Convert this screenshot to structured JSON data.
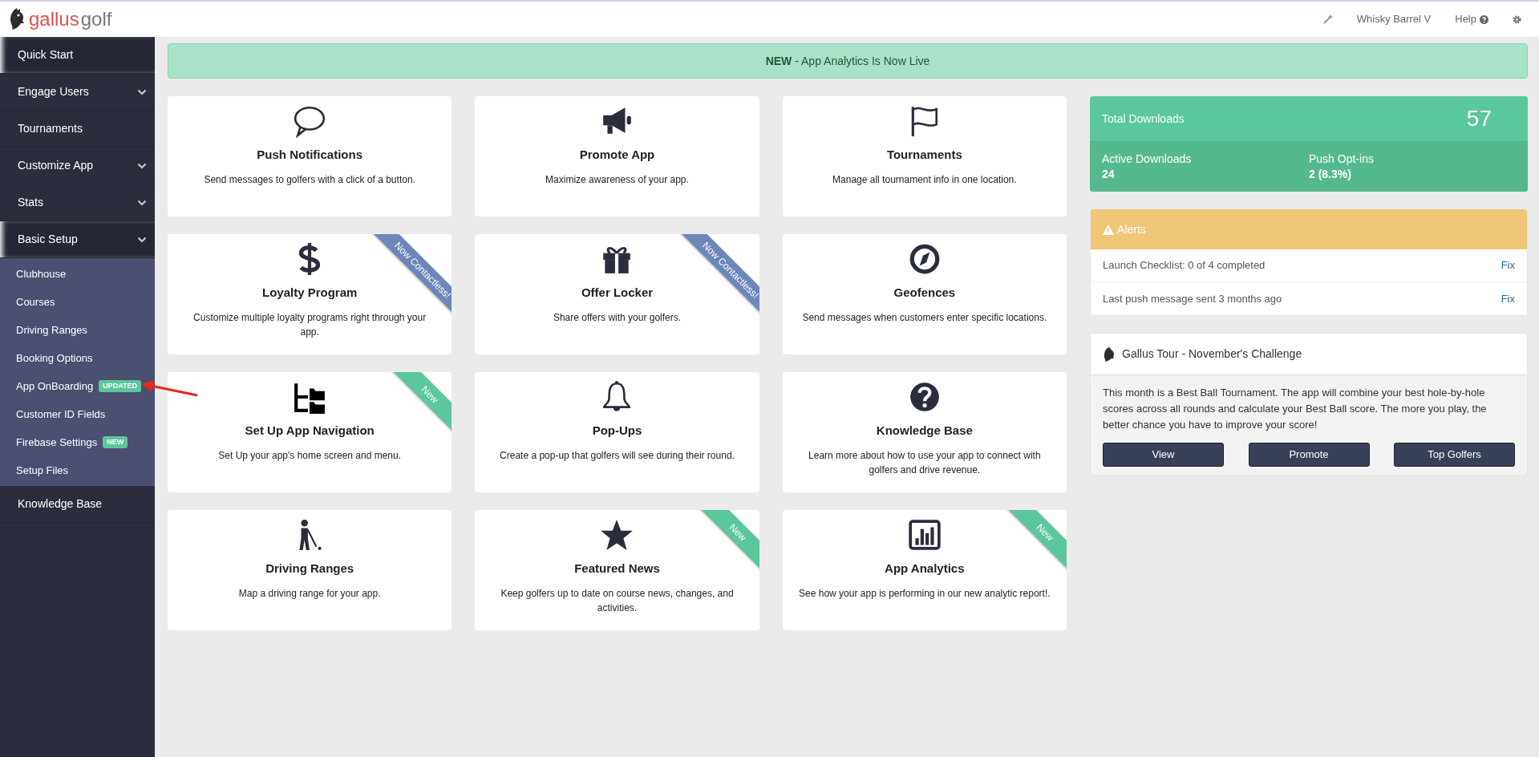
{
  "header": {
    "logo": {
      "word_1": "gallus",
      "word_2": "golf"
    },
    "links": [
      {
        "kind": "wand"
      },
      {
        "kind": "text",
        "label": "Whisky Barrel V"
      },
      {
        "kind": "help",
        "label": "Help"
      },
      {
        "kind": "gear"
      }
    ]
  },
  "sidebar": {
    "items": [
      {
        "label": "Quick Start",
        "kind": "link",
        "selected": true
      },
      {
        "label": "Engage Users",
        "kind": "group",
        "selected": false
      },
      {
        "label": "Tournaments",
        "kind": "link",
        "selected": false
      },
      {
        "label": "Customize App",
        "kind": "group",
        "selected": false
      },
      {
        "label": "Stats",
        "kind": "group",
        "selected": false
      },
      {
        "label": "Basic Setup",
        "kind": "group",
        "selected": true,
        "children": [
          {
            "label": "Clubhouse"
          },
          {
            "label": "Courses"
          },
          {
            "label": "Driving Ranges"
          },
          {
            "label": "Booking Options"
          },
          {
            "label": "App OnBoarding",
            "badge": {
              "text": "UPDATED",
              "color": "#5bc79c"
            },
            "pointer": true
          },
          {
            "label": "Customer ID Fields"
          },
          {
            "label": "Firebase Settings",
            "badge": {
              "text": "NEW",
              "color": "#5bc79c"
            }
          },
          {
            "label": "Setup Files"
          }
        ]
      },
      {
        "label": "Knowledge Base",
        "kind": "link",
        "selected": false
      }
    ]
  },
  "banner": {
    "text": "**NEW** - App Analytics Is Now Live"
  },
  "cards": [
    {
      "kind": "speech",
      "title": "Push Notifications",
      "description": "Send messages to golfers with a click of a button."
    },
    {
      "kind": "megaphone",
      "title": "Promote App",
      "description": "Maximize awareness of your app."
    },
    {
      "kind": "flag",
      "title": "Tournaments",
      "description": "Manage all tournament info in one location."
    },
    {
      "kind": "dollar",
      "title": "Loyalty Program",
      "description": "Customize multiple loyalty programs right through your app.",
      "ribbon": {
        "text": "Now Contactless!",
        "color": "#6c87b9"
      }
    },
    {
      "kind": "gift",
      "title": "Offer Locker",
      "description": "Share offers with your golfers.",
      "ribbon": {
        "text": "Now Contactless!",
        "color": "#6c87b9"
      }
    },
    {
      "kind": "compass",
      "title": "Geofences",
      "description": "Send messages when customers enter specific locations."
    },
    {
      "kind": "tree",
      "title": "Set Up App Navigation",
      "description": "Set Up your app's home screen and menu.",
      "ribbon": {
        "text": "New",
        "color": "#5bc79c"
      }
    },
    {
      "kind": "bell",
      "title": "Pop-Ups",
      "description": "Create a pop-up that golfers will see during their round."
    },
    {
      "kind": "question",
      "title": "Knowledge Base",
      "description": "Learn more about how to use your app to connect with golfers and drive revenue."
    },
    {
      "kind": "golfer",
      "title": "Driving Ranges",
      "description": "Map a driving range for your app."
    },
    {
      "kind": "star",
      "title": "Featured News",
      "description": "Keep golfers up to date on course news, changes, and activities.",
      "ribbon": {
        "text": "New",
        "color": "#5bc79c"
      }
    },
    {
      "kind": "chart",
      "title": "App Analytics",
      "description": "See how your app is performing in our new analytic report!.",
      "ribbon": {
        "text": "New",
        "color": "#5bc79c"
      }
    }
  ],
  "stats": {
    "total_label": "Total Downloads",
    "total_value": "57",
    "metrics": [
      {
        "label": "Active Downloads",
        "value": "24"
      },
      {
        "label": "Push Opt-ins",
        "value": "2 (8.3%)"
      }
    ]
  },
  "alerts": {
    "title": "Alerts",
    "items": [
      {
        "text": "Launch Checklist: 0 of 4 completed",
        "action": "Fix"
      },
      {
        "text": "Last push message sent 3 months ago",
        "action": "Fix"
      }
    ]
  },
  "tour": {
    "title": "Gallus Tour - November's Challenge",
    "description": "This month is a Best Ball Tournament. The app will combine your best hole-by-hole scores across all rounds and calculate your Best Ball score. The more you play, the better chance you have to improve your score!",
    "buttons": [
      "View",
      "Promote",
      "Top Golfers"
    ]
  }
}
